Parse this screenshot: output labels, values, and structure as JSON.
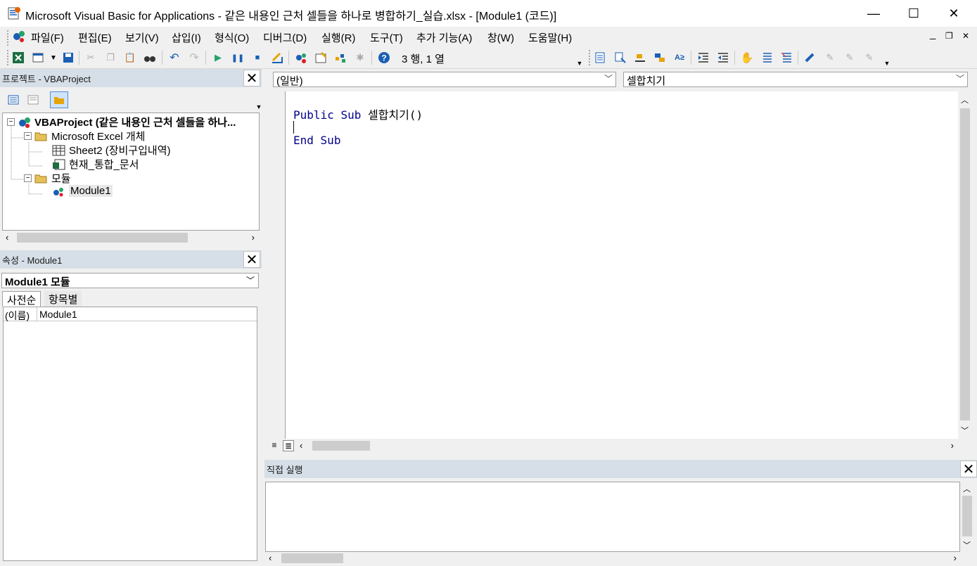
{
  "window": {
    "title": "Microsoft Visual Basic for Applications - 같은 내용인 근처 셀들을 하나로 병합하기_실습.xlsx - [Module1 (코드)]",
    "minimize": "—",
    "maximize": "☐",
    "close": "✕"
  },
  "menu": {
    "items": [
      "파일(F)",
      "편집(E)",
      "보기(V)",
      "삽입(I)",
      "형식(O)",
      "디버그(D)",
      "실행(R)",
      "도구(T)",
      "추가 기능(A)",
      "창(W)",
      "도움말(H)"
    ],
    "mdi_min": "_",
    "mdi_restore": "❐",
    "mdi_close": "✕"
  },
  "toolbar": {
    "position": "3 행, 1 열"
  },
  "project": {
    "header": "프로젝트 - VBAProject",
    "root": "VBAProject (같은 내용인 근처 셀들을 하나...",
    "excel_objects": "Microsoft Excel 개체",
    "sheet2": "Sheet2 (장비구입내역)",
    "workbook": "현재_통합_문서",
    "modules": "모듈",
    "module1": "Module1"
  },
  "properties": {
    "header": "속성 - Module1",
    "selected_object": "Module1 모듈",
    "tabs": [
      "사전순",
      "항목별"
    ],
    "rows": [
      {
        "name": "(이름)",
        "value": "Module1"
      }
    ]
  },
  "code": {
    "object_combo": "(일반)",
    "procedure_combo": "셀합치기",
    "lines": [
      {
        "kw1": "Public",
        "kw2": "Sub",
        "text": " 셀합치기()"
      },
      {
        "kw1": "",
        "kw2": "",
        "text": ""
      },
      {
        "kw1": "End",
        "kw2": "Sub",
        "text": ""
      }
    ]
  },
  "immediate": {
    "header": "직접 실행"
  }
}
